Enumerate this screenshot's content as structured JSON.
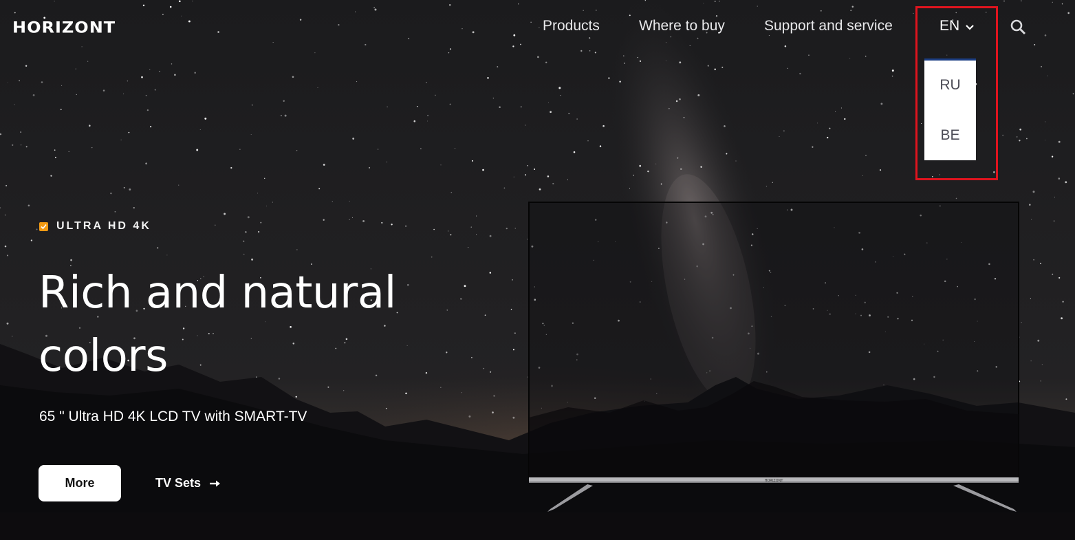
{
  "header": {
    "logo_text": "HORIZONT",
    "nav": [
      {
        "label": "Products"
      },
      {
        "label": "Where to buy"
      },
      {
        "label": "Support and service"
      }
    ],
    "language": {
      "current": "EN",
      "options": [
        {
          "label": "RU"
        },
        {
          "label": "BE"
        }
      ]
    },
    "search_icon": "search-icon"
  },
  "hero": {
    "badge": "ULTRA HD 4K",
    "headline_line1": "Rich and natural",
    "headline_line2": "colors",
    "subtitle": "65 \" Ultra HD 4K LCD TV with SMART-TV",
    "more_label": "More",
    "tv_sets_label": "TV Sets",
    "tv_brand": "HORIZONT"
  },
  "colors": {
    "badge_accent": "#f19a14",
    "highlight_border": "#e0141e",
    "dropdown_top_border": "#1b3d82"
  }
}
